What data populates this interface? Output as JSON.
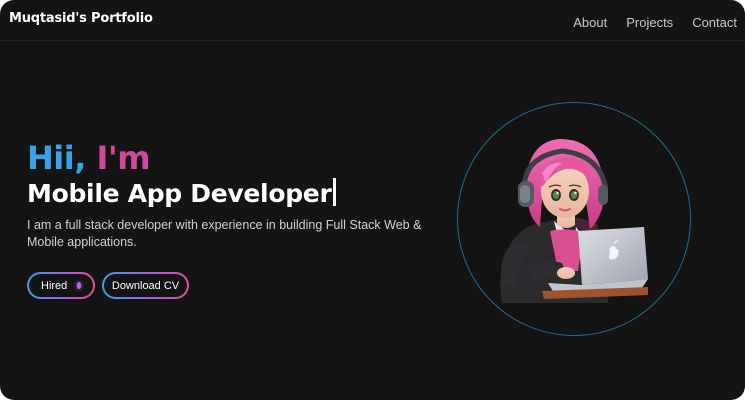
{
  "nav": {
    "brand": "Muqtasid's Portfolio",
    "links": [
      "About",
      "Projects",
      "Contact"
    ]
  },
  "hero": {
    "greeting_part1": "Hii,",
    "greeting_part2": "I'm",
    "role": "Mobile App Developer",
    "description": "I am a full stack developer with experience in building Full Stack Web & Mobile applications.",
    "buttons": {
      "hired": "Hired",
      "download_cv": "Download CV"
    }
  },
  "colors": {
    "background": "#141414",
    "accent_blue": "#36a3e6",
    "accent_pink": "#cf4a9a",
    "ring": "#1f6d92"
  }
}
